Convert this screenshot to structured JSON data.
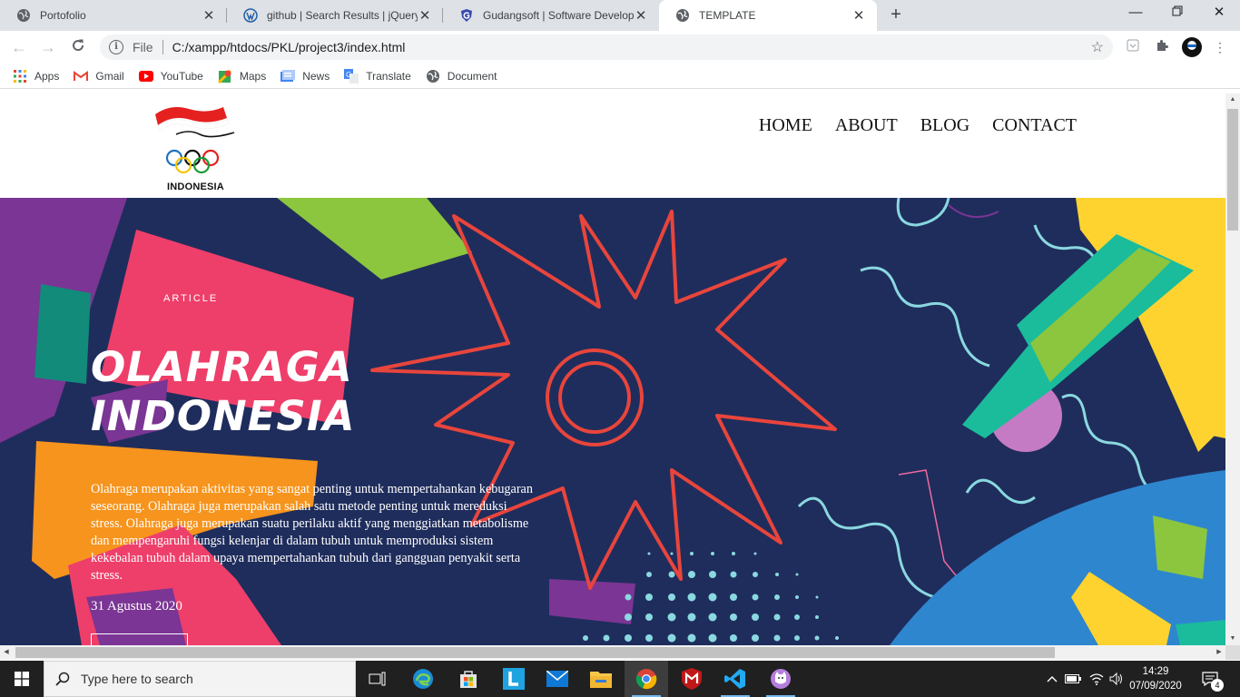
{
  "browser": {
    "tabs": [
      {
        "title": "Portofolio",
        "icon": "globe-icon",
        "active": false
      },
      {
        "title": "github | Search Results | jQuery A",
        "icon": "wordpress-icon",
        "active": false
      },
      {
        "title": "Gudangsoft | Software Developer",
        "icon": "shield-icon",
        "active": false
      },
      {
        "title": "TEMPLATE",
        "icon": "globe-icon",
        "active": true
      }
    ],
    "new_tab_label": "+",
    "address": {
      "scheme_label": "File",
      "url": "C:/xampp/htdocs/PKL/project3/index.html"
    },
    "bookmarks": [
      {
        "label": "Apps",
        "icon": "apps-grid-icon"
      },
      {
        "label": "Gmail",
        "icon": "gmail-icon"
      },
      {
        "label": "YouTube",
        "icon": "youtube-icon"
      },
      {
        "label": "Maps",
        "icon": "maps-icon"
      },
      {
        "label": "News",
        "icon": "news-icon"
      },
      {
        "label": "Translate",
        "icon": "translate-icon"
      },
      {
        "label": "Document",
        "icon": "globe-icon"
      }
    ]
  },
  "site": {
    "logo_text": "INDONESIA",
    "nav": [
      "HOME",
      "ABOUT",
      "BLOG",
      "CONTACT"
    ],
    "hero": {
      "eyebrow": "ARTICLE",
      "title_line1": "OLAHRAGA",
      "title_line2": "INDONESIA",
      "body": "Olahraga merupakan aktivitas yang sangat penting untuk mempertahankan kebugaran seseorang. Olahraga juga merupakan salah satu metode penting untuk mereduksi stress. Olahraga juga merupakan suatu perilaku aktif yang menggiatkan metabolisme dan mempengaruhi fungsi kelenjar di dalam tubuh untuk memproduksi sistem kekebalan tubuh dalam upaya mempertahankan tubuh dari gangguan penyakit serta stress.",
      "date": "31 Agustus 2020"
    },
    "colors": {
      "hero_bg": "#1f2d5c",
      "red": "#e8453c",
      "pink": "#ee3f6a",
      "orange": "#f7941d",
      "green": "#8cc63f",
      "teal": "#1abc9c",
      "purple": "#7b3594",
      "yellow": "#fed330",
      "blue": "#2e86cf"
    }
  },
  "taskbar": {
    "search_placeholder": "Type here to search",
    "apps": [
      "task-view-icon",
      "edge-icon",
      "store-icon",
      "launcher-l-icon",
      "mail-icon",
      "file-explorer-icon",
      "chrome-icon",
      "mcafee-icon",
      "vscode-icon",
      "cat-app-icon"
    ],
    "clock_time": "14:29",
    "clock_date": "07/09/2020",
    "notification_count": "4"
  }
}
